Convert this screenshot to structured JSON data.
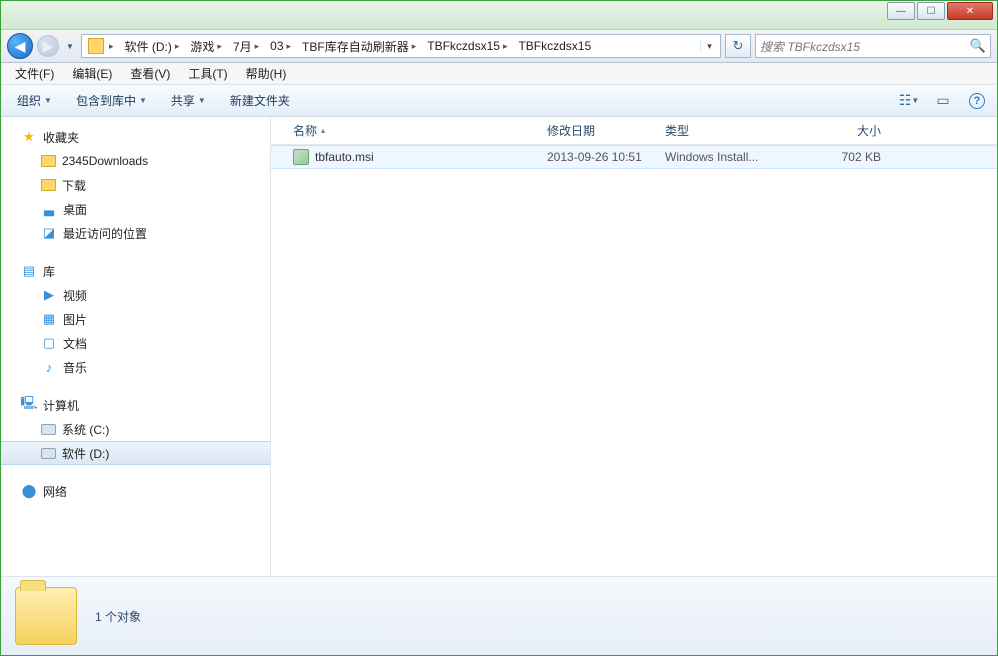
{
  "breadcrumb": [
    "软件 (D:)",
    "游戏",
    "7月",
    "03",
    "TBF库存自动刷新器",
    "TBFkczdsx15",
    "TBFkczdsx15"
  ],
  "search_placeholder": "搜索 TBFkczdsx15",
  "menus": {
    "file": "文件(F)",
    "edit": "编辑(E)",
    "view": "查看(V)",
    "tools": "工具(T)",
    "help": "帮助(H)"
  },
  "toolbar": {
    "organize": "组织",
    "include": "包含到库中",
    "share": "共享",
    "newfolder": "新建文件夹"
  },
  "sidebar": {
    "favorites": "收藏夹",
    "fav_items": [
      "2345Downloads",
      "下载",
      "桌面",
      "最近访问的位置"
    ],
    "libraries": "库",
    "lib_items": [
      "视频",
      "图片",
      "文档",
      "音乐"
    ],
    "computer": "计算机",
    "drives": [
      "系统 (C:)",
      "软件 (D:)"
    ],
    "network": "网络"
  },
  "columns": {
    "name": "名称",
    "date": "修改日期",
    "type": "类型",
    "size": "大小"
  },
  "files": [
    {
      "name": "tbfauto.msi",
      "date": "2013-09-26 10:51",
      "type": "Windows Install...",
      "size": "702 KB"
    }
  ],
  "status": "1 个对象"
}
